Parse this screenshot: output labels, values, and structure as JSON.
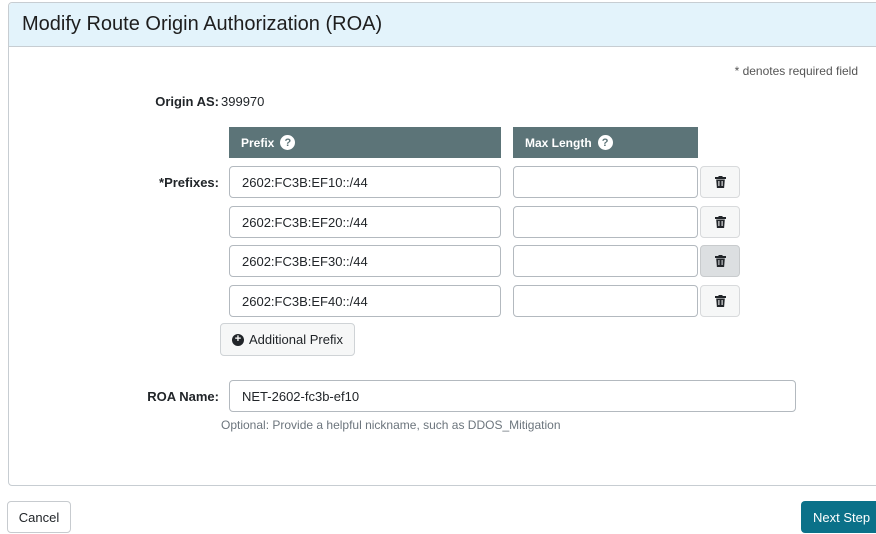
{
  "panel": {
    "title": "Modify Route Origin Authorization (ROA)",
    "required_note": "* denotes required field"
  },
  "origin_as": {
    "label": "Origin AS:",
    "value": "399970"
  },
  "prefixes": {
    "label": "*Prefixes:",
    "col_prefix": "Prefix",
    "col_max_length": "Max Length",
    "help_glyph": "?",
    "rows": [
      {
        "prefix": "2602:FC3B:EF10::/44",
        "max_length": ""
      },
      {
        "prefix": "2602:FC3B:EF20::/44",
        "max_length": ""
      },
      {
        "prefix": "2602:FC3B:EF30::/44",
        "max_length": ""
      },
      {
        "prefix": "2602:FC3B:EF40::/44",
        "max_length": ""
      }
    ],
    "delete_icon": "trash-icon",
    "add_label": "Additional Prefix",
    "add_icon": "plus-circle-icon"
  },
  "roa_name": {
    "label": "ROA Name:",
    "value": "NET-2602-fc3b-ef10",
    "help": "Optional: Provide a helpful nickname, such as DDOS_Mitigation"
  },
  "footer": {
    "cancel_label": "Cancel",
    "next_label": "Next Step"
  },
  "colors": {
    "header_bg": "#e3f3fb",
    "column_header_bg": "#5c7478",
    "primary_button": "#0b7189"
  }
}
